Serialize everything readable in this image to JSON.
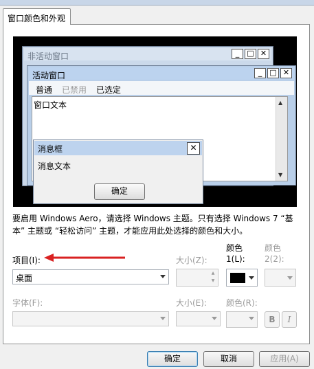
{
  "tab": {
    "label": "窗口颜色和外观"
  },
  "preview": {
    "inactive_window": {
      "title": "非活动窗口"
    },
    "active_window": {
      "title": "活动窗口",
      "menu": [
        "普通",
        "已禁用",
        "已选定"
      ],
      "window_text": "窗口文本"
    },
    "caption_buttons": {
      "minimize": "_",
      "maximize": "□",
      "close": "✕"
    },
    "message_box": {
      "title": "消息框",
      "text": "消息文本",
      "ok_label": "确定",
      "close": "✕"
    }
  },
  "description": "要启用 Windows Aero，请选择 Windows 主题。只有选择 Windows 7 “基本” 主题或 “轻松访问” 主题，才能应用此处选择的颜色和大小。",
  "item": {
    "label": "项目(I):",
    "value": "桌面"
  },
  "size1": {
    "label": "大小(Z):"
  },
  "color1": {
    "label_line1": "颜色",
    "label_line2": "1(L):",
    "swatch": "#000000"
  },
  "color2": {
    "label_line1": "颜色",
    "label_line2": "2(2):"
  },
  "font": {
    "label": "字体(F):"
  },
  "font_size": {
    "label": "大小(E):"
  },
  "font_color": {
    "label": "颜色(R):"
  },
  "bold_label": "B",
  "italic_label": "I",
  "buttons": {
    "ok": "确定",
    "cancel": "取消",
    "apply": "应用(A)"
  },
  "colors": {
    "annotation_arrow": "#d92121"
  }
}
